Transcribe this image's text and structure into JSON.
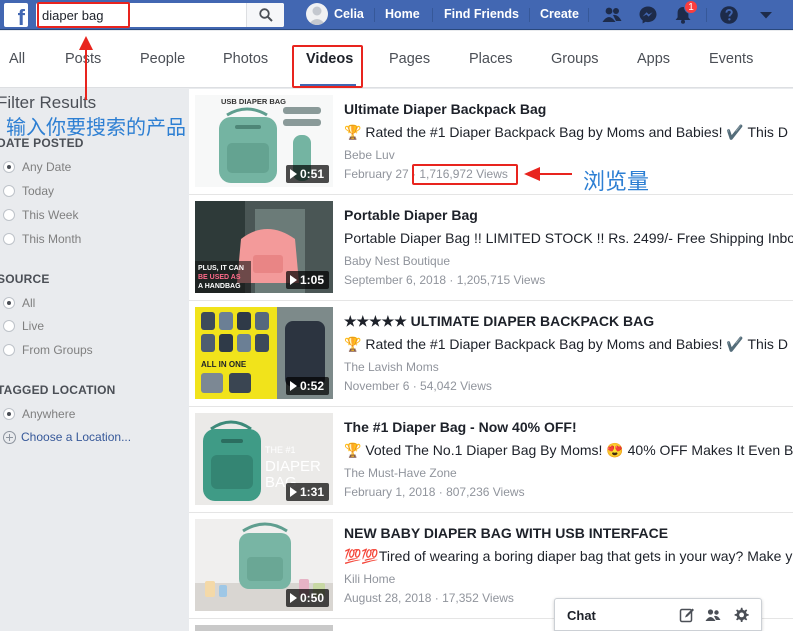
{
  "header": {
    "search_value": "diaper bag",
    "user_name": "Celia",
    "home_label": "Home",
    "find_friends_label": "Find Friends",
    "create_label": "Create",
    "notification_count": "1",
    "brand_color": "#4267b2"
  },
  "tabs": [
    {
      "label": "All"
    },
    {
      "label": "Posts"
    },
    {
      "label": "People"
    },
    {
      "label": "Photos"
    },
    {
      "label": "Videos",
      "active": true
    },
    {
      "label": "Pages"
    },
    {
      "label": "Places"
    },
    {
      "label": "Groups"
    },
    {
      "label": "Apps"
    },
    {
      "label": "Events"
    }
  ],
  "sidebar": {
    "title": "Filter Results",
    "date_posted": {
      "heading": "DATE POSTED",
      "options": [
        "Any Date",
        "Today",
        "This Week",
        "This Month"
      ],
      "selected": "Any Date"
    },
    "source": {
      "heading": "SOURCE",
      "options": [
        "All",
        "Live",
        "From Groups"
      ],
      "selected": "All"
    },
    "tagged_location": {
      "heading": "TAGGED LOCATION",
      "options": [
        "Anywhere"
      ],
      "selected": "Anywhere",
      "choose_label": "Choose a Location..."
    }
  },
  "results": [
    {
      "title": "Ultimate Diaper Backpack Bag",
      "desc": "Rated the #1 Diaper Backpack Bag by Moms and Babies! ✔️ This D",
      "source": "Bebe Luv",
      "date": "February 27",
      "views": "1,716,972 Views",
      "duration": "0:51",
      "thumb_text": "USB DIAPER BAG"
    },
    {
      "title": "Portable Diaper Bag",
      "desc": "Portable Diaper Bag !! LIMITED STOCK !! Rs. 2499/- Free Shipping Inbo",
      "source": "Baby Nest Boutique",
      "date": "September 6, 2018",
      "views": "1,205,715 Views",
      "duration": "1:05",
      "thumb_text_1": "PLUS, IT CAN",
      "thumb_text_2": "BE USED AS",
      "thumb_text_3": "A HANDBAG"
    },
    {
      "title": "★★★★★ ULTIMATE DIAPER BACKPACK BAG",
      "desc": "Rated the #1 Diaper Backpack Bag by Moms and Babies! ✔️ This D",
      "source": "The Lavish Moms",
      "date": "November 6",
      "views": "54,042 Views",
      "duration": "0:52",
      "thumb_text": "ALL IN ONE"
    },
    {
      "title": "The #1 Diaper Bag - Now 40% OFF!",
      "desc_before": "Voted The No.1 Diaper Bag By Moms!",
      "desc_after": "40% OFF Makes It Even B",
      "source": "The Must-Have Zone",
      "date": "February 1, 2018",
      "views": "807,236 Views",
      "duration": "1:31",
      "thumb_text_1": "THE #1",
      "thumb_text_2": "DIAPER",
      "thumb_text_3": "BAG"
    },
    {
      "title": "NEW BABY DIAPER BAG WITH USB INTERFACE",
      "desc": "Tired of wearing a boring diaper bag that gets in your way? Make y",
      "source": "Kili Home",
      "date": "August 28, 2018",
      "views": "17,352 Views",
      "duration": "0:50"
    }
  ],
  "chat": {
    "label": "Chat"
  },
  "annotations": {
    "search_hint": "输入你要搜索的产品",
    "views_hint": "浏览量",
    "annotation_red": "#e8241e",
    "annotation_blue": "#2d7fd3"
  }
}
